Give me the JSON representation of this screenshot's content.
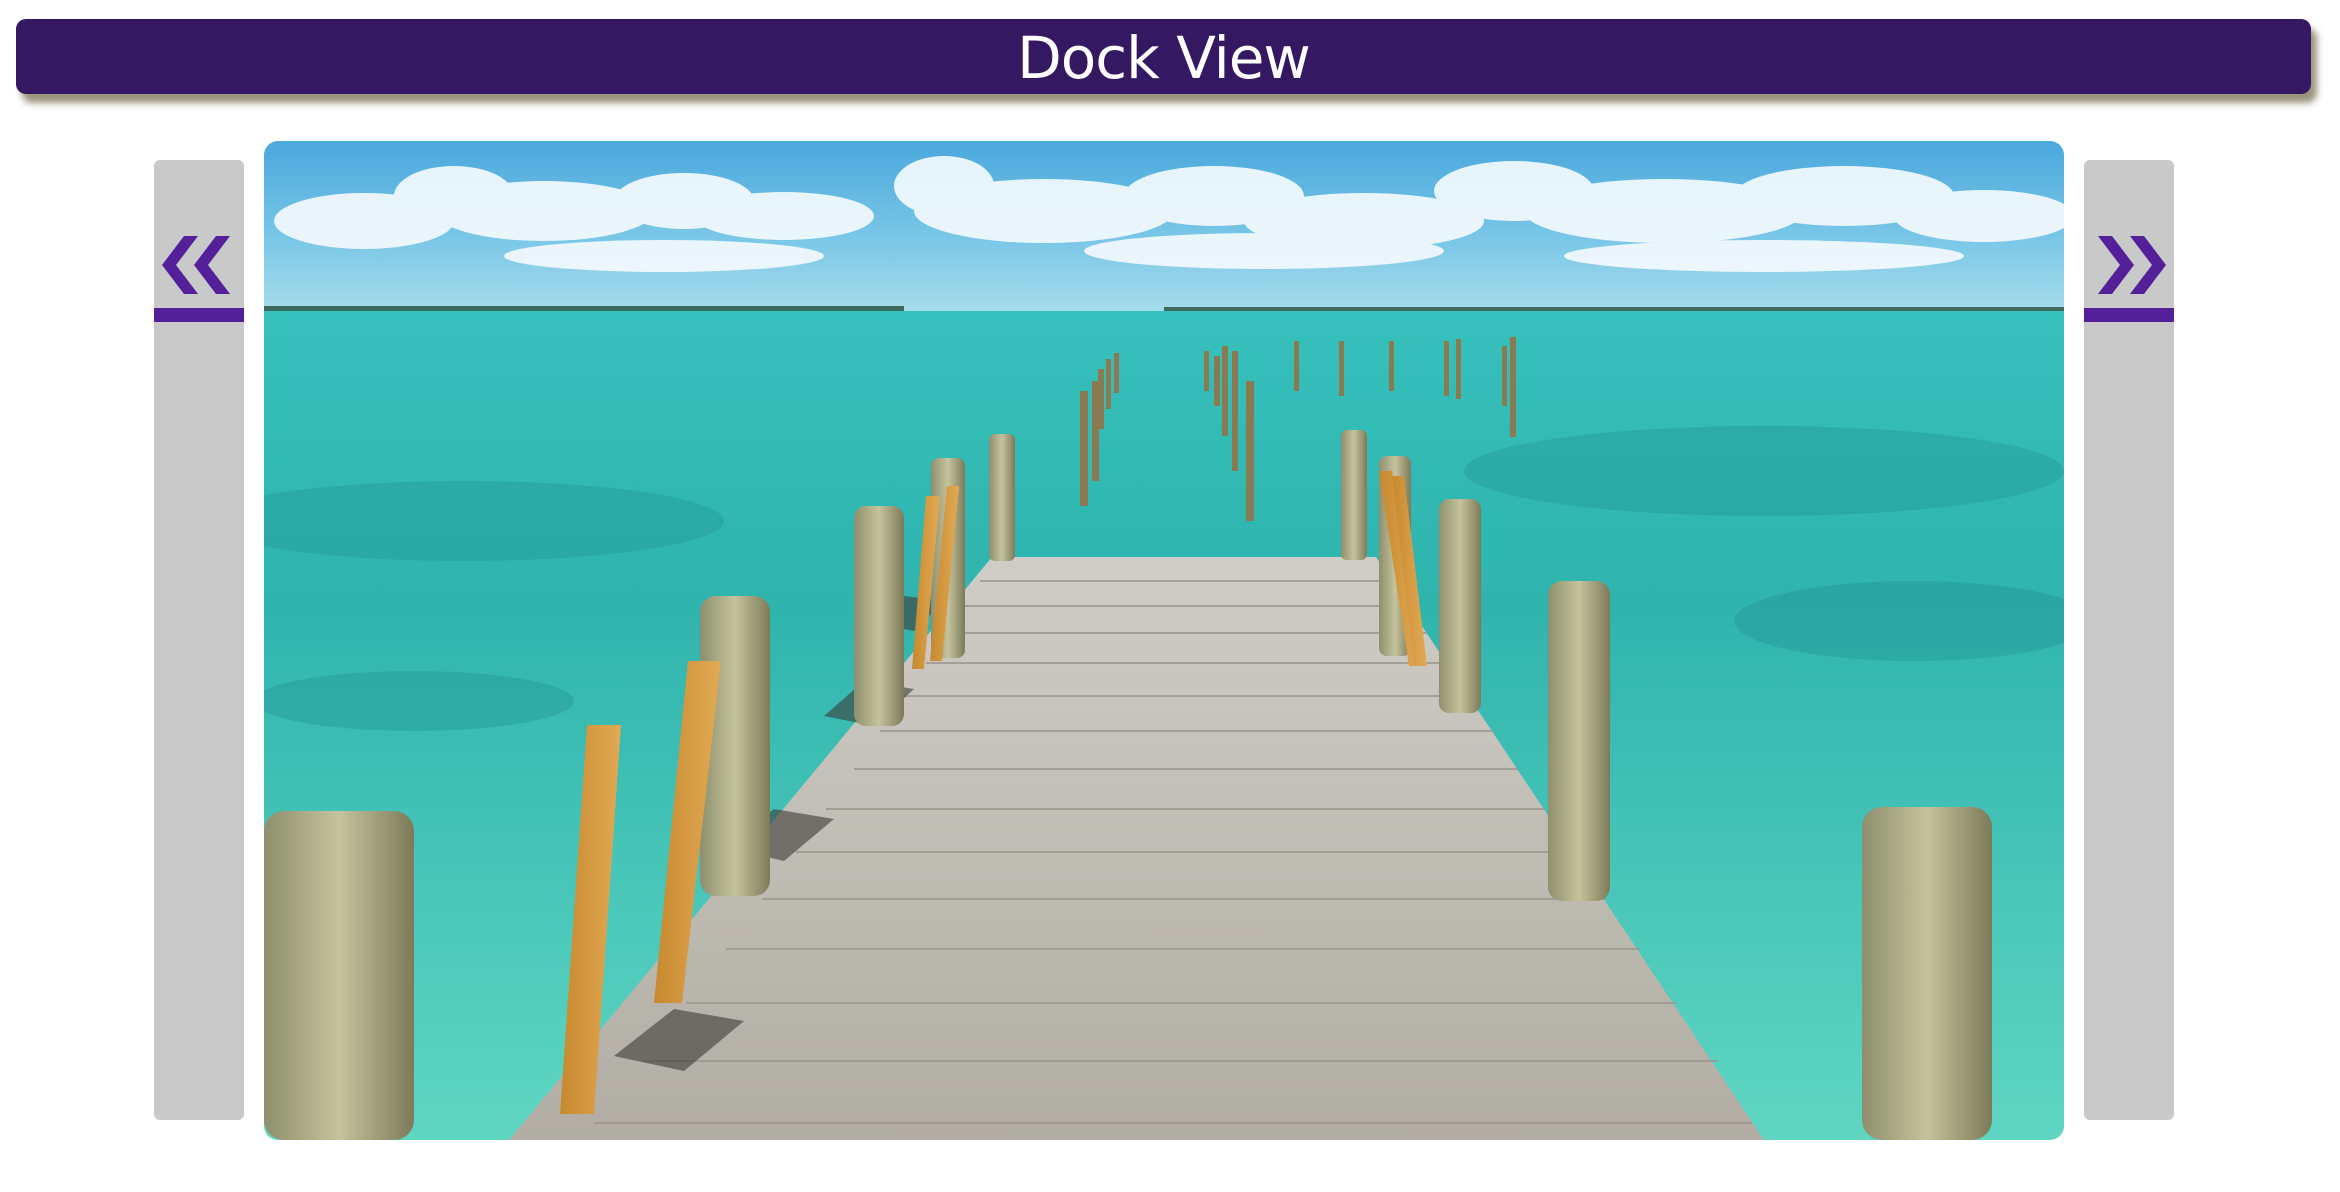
{
  "header": {
    "title": "Dock View"
  },
  "carousel": {
    "prev_icon": "double-chevron-left-icon",
    "next_icon": "double-chevron-right-icon",
    "image_alt": ""
  },
  "colors": {
    "title_bar": "#351862",
    "title_text": "#ffffff",
    "nav_strip": "#c9c9c9",
    "accent": "#53209a",
    "sky": "#5fb7e0",
    "sea": "#3cc7b8",
    "dock": "#bdbab3"
  }
}
